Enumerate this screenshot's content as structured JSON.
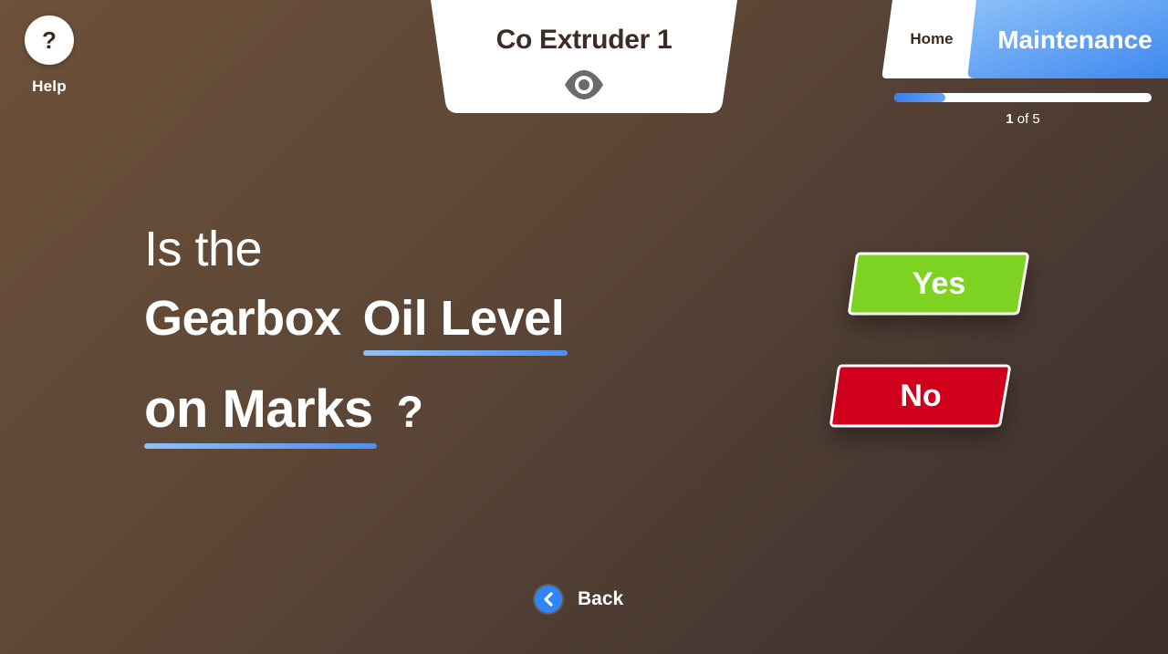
{
  "help": {
    "icon": "question-mark-icon",
    "glyph": "?",
    "label": "Help"
  },
  "machine": {
    "title": "Co Extruder 1",
    "view_icon": "eye-icon"
  },
  "nav": {
    "home_label": "Home",
    "maintenance_label": "Maintenance",
    "active_tab": "Maintenance",
    "accent_color": "#4a90f2"
  },
  "progress": {
    "current": "1",
    "of_text": " of 5",
    "total": 5,
    "fraction": 0.2
  },
  "question": {
    "line1": "Is the",
    "part_gearbox": "Gearbox",
    "part_oil_level": "Oil Level",
    "part_on_marks": "on Marks",
    "question_mark": "?"
  },
  "answers": {
    "yes_label": "Yes",
    "yes_color": "#7ed321",
    "no_label": "No",
    "no_color": "#d0021b"
  },
  "back": {
    "icon": "chevron-left-icon",
    "label": "Back"
  }
}
